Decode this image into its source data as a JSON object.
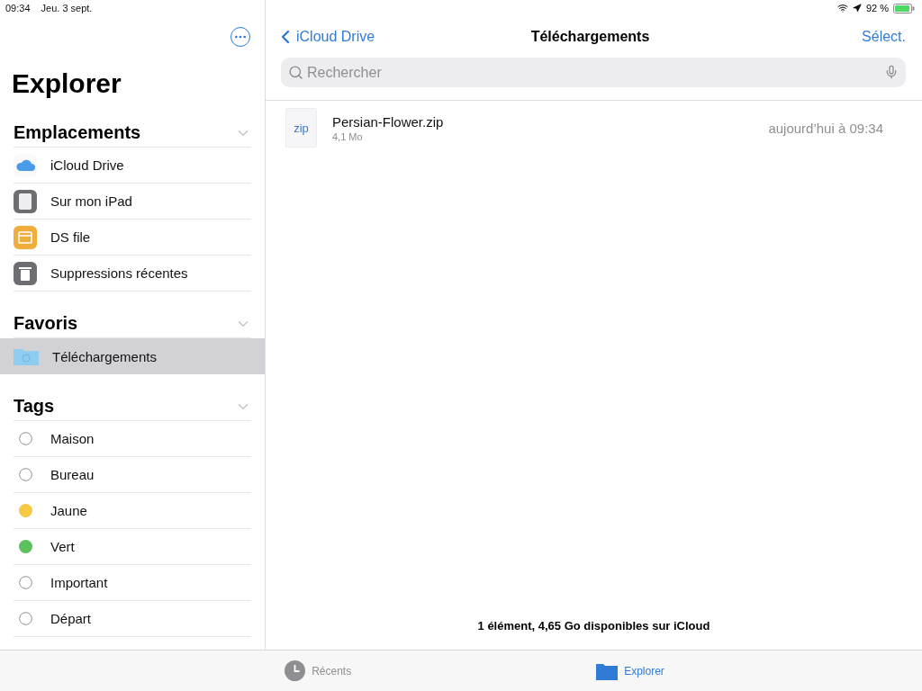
{
  "status_bar": {
    "time": "09:34",
    "date": "Jeu. 3 sept.",
    "battery": "92 %"
  },
  "sidebar": {
    "title": "Explorer",
    "sections": [
      {
        "title": "Emplacements",
        "expanded": true,
        "items": [
          {
            "label": "iCloud Drive",
            "kind": "cloud",
            "selected": false
          },
          {
            "label": "Sur mon iPad",
            "kind": "ipad",
            "selected": false
          },
          {
            "label": "DS file",
            "kind": "folder",
            "selected": false
          },
          {
            "label": "Suppressions récentes",
            "kind": "trash",
            "selected": false
          }
        ]
      },
      {
        "title": "Favoris",
        "expanded": true,
        "items": [
          {
            "label": "Téléchargements",
            "kind": "downloads",
            "selected": true
          }
        ]
      },
      {
        "title": "Tags",
        "expanded": true,
        "items": [
          {
            "label": "Maison",
            "kind": "tag",
            "selected": false
          },
          {
            "label": "Bureau",
            "kind": "tag",
            "selected": false
          },
          {
            "label": "Jaune",
            "kind": "tag",
            "color": "#f7c843",
            "selected": false
          },
          {
            "label": "Vert",
            "kind": "tag",
            "color": "#5cc15c",
            "selected": false
          },
          {
            "label": "Important",
            "kind": "tag",
            "selected": false
          },
          {
            "label": "Départ",
            "kind": "tag",
            "selected": false
          }
        ]
      }
    ]
  },
  "navigation": {
    "back": "iCloud Drive",
    "title": "Téléchargements",
    "action": "Sélect."
  },
  "search": {
    "placeholder": "Rechercher"
  },
  "files": [
    {
      "name": "Persian-Flower.zip",
      "type": "zip",
      "size": "4,1 Mo",
      "date": "aujourd’hui à 09:34"
    }
  ],
  "footer": "1 élément, 4,65 Go disponibles sur iCloud",
  "tab_bar": [
    {
      "label": "Récents",
      "kind": "recent",
      "selected": false
    },
    {
      "label": "Explorer",
      "kind": "browse",
      "selected": true
    }
  ]
}
